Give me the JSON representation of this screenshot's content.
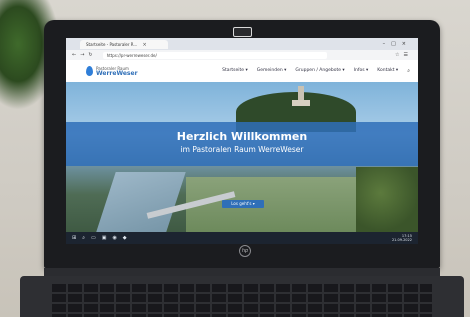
{
  "browser": {
    "tab_title": "Startseite - Pastoraler R...",
    "url": "https://pr-werreweser.de/"
  },
  "site": {
    "logo_small": "Pastoraler Raum",
    "logo_big": "WerreWeser",
    "nav": [
      "Startseite ▾",
      "Gemeinden ▾",
      "Gruppen / Angebote ▾",
      "Infos ▾",
      "Kontakt ▾"
    ]
  },
  "hero": {
    "title": "Herzlich Willkommen",
    "subtitle": "im Pastoralen Raum WerreWeser",
    "cta": "Los geht's ▾"
  },
  "taskbar": {
    "time": "17:15",
    "date": "21.09.2022"
  },
  "device": {
    "brand": "hp"
  },
  "icons": [
    "tab-close-icon",
    "back-icon",
    "forward-icon",
    "refresh-icon",
    "search-icon",
    "windows-start-icon"
  ]
}
